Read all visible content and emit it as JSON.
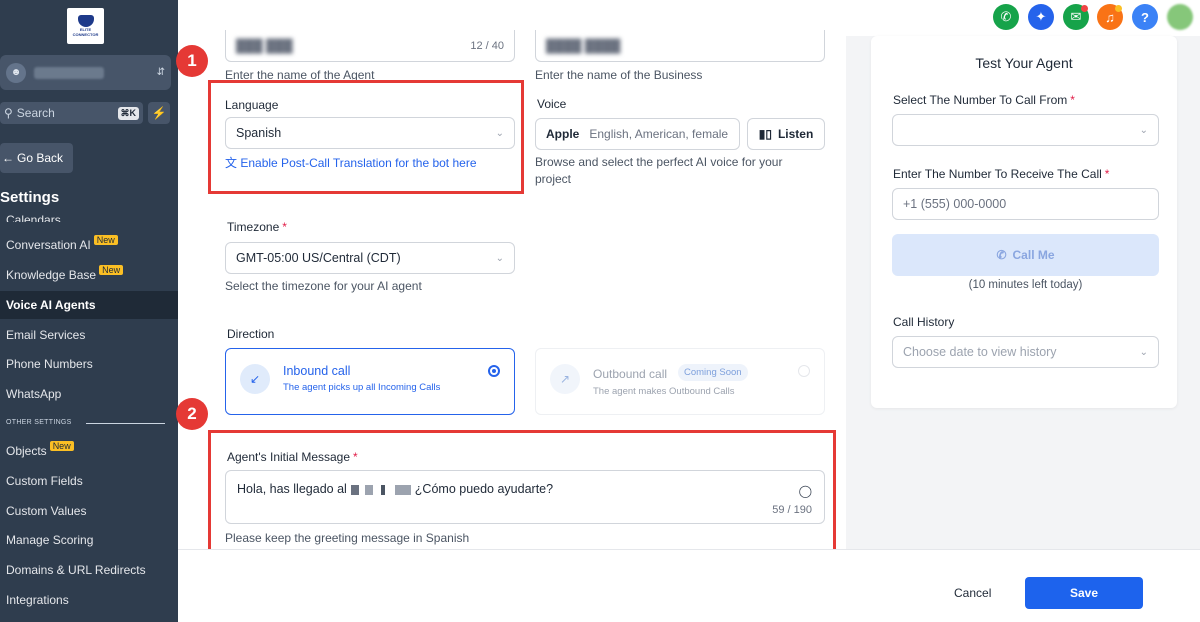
{
  "brand": {
    "logo_text": "ELITE CONNECTOR"
  },
  "sidebar": {
    "search_placeholder": "Search",
    "search_shortcut": "⌘K",
    "go_back": "Go Back",
    "settings_title": "Settings",
    "partial_item": "Calendars",
    "items": [
      {
        "label": "Conversation AI",
        "badge": "New"
      },
      {
        "label": "Knowledge Base",
        "badge": "New"
      },
      {
        "label": "Voice AI Agents"
      },
      {
        "label": "Email Services"
      },
      {
        "label": "Phone Numbers"
      },
      {
        "label": "WhatsApp"
      }
    ],
    "other_settings_label": "OTHER SETTINGS",
    "other_items": [
      {
        "label": "Objects",
        "badge": "New"
      },
      {
        "label": "Custom Fields"
      },
      {
        "label": "Custom Values"
      },
      {
        "label": "Manage Scoring"
      },
      {
        "label": "Domains & URL Redirects"
      },
      {
        "label": "Integrations"
      }
    ]
  },
  "topbar": {
    "icons": [
      "phone-icon",
      "sparkle-icon",
      "megaphone-icon",
      "bell-icon",
      "help-icon"
    ],
    "help_label": "?",
    "colors": {
      "phone": "#16a34a",
      "sparkle": "#2563eb",
      "megaphone": "#16a34a",
      "bell": "#f97316",
      "help": "#3b82f6"
    }
  },
  "form": {
    "agent_name": {
      "counter": "12 / 40",
      "hint": "Enter the name of the Agent"
    },
    "business_name": {
      "hint": "Enter the name of the Business"
    },
    "language": {
      "label": "Language",
      "value": "Spanish",
      "translation_link": "Enable Post-Call Translation for the bot here"
    },
    "voice": {
      "label": "Voice",
      "name": "Apple",
      "description": "English, American, female",
      "listen": "Listen",
      "hint_line1": "Browse and select the perfect AI voice for your",
      "hint_line2": "project"
    },
    "timezone": {
      "label": "Timezone",
      "value": "GMT-05:00 US/Central (CDT)",
      "hint": "Select the timezone for your AI agent"
    },
    "direction": {
      "label": "Direction",
      "inbound": {
        "title": "Inbound call",
        "desc": "The agent picks up all Incoming Calls",
        "selected": true
      },
      "outbound": {
        "title": "Outbound call",
        "badge": "Coming Soon",
        "desc": "The agent makes Outbound Calls",
        "selected": false
      }
    },
    "initial_message": {
      "label": "Agent's Initial Message",
      "text_start": "Hola, has llegado al",
      "text_end": "¿Cómo puedo ayudarte?",
      "counter": "59 / 190",
      "hint": "Please keep the greeting message in Spanish"
    }
  },
  "annotations": {
    "one": "1",
    "two": "2"
  },
  "test_panel": {
    "title": "Test Your Agent",
    "from_label": "Select The Number To Call From",
    "to_label": "Enter The Number To Receive The Call",
    "to_placeholder": "+1 (555) 000-0000",
    "call_button": "Call Me",
    "minutes_left": "(10 minutes left today)",
    "history_label": "Call History",
    "history_placeholder": "Choose date to view history"
  },
  "footer": {
    "cancel": "Cancel",
    "save": "Save"
  }
}
